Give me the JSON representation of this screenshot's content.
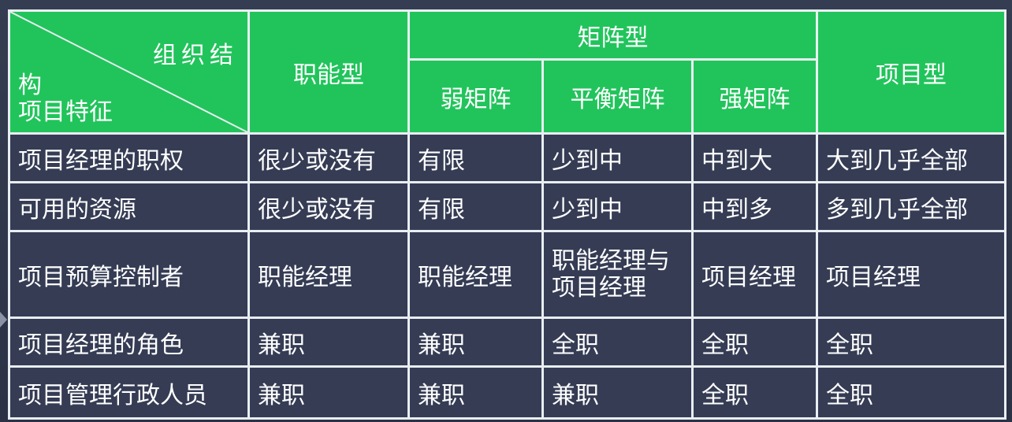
{
  "corner": {
    "org_label_top": "组织结",
    "org_label_bottom": "构",
    "feature_label": "项目特征"
  },
  "headers": {
    "functional": "职能型",
    "matrix": "矩阵型",
    "weak_matrix": "弱矩阵",
    "balanced_matrix": "平衡矩阵",
    "strong_matrix": "强矩阵",
    "projectized": "项目型"
  },
  "rows": [
    {
      "feature": "项目经理的职权",
      "functional": "很少或没有",
      "weak": "有限",
      "balanced": "少到中",
      "strong": "中到大",
      "projectized": "大到几乎全部"
    },
    {
      "feature": "可用的资源",
      "functional": "很少或没有",
      "weak": "有限",
      "balanced": "少到中",
      "strong": "中到多",
      "projectized": "多到几乎全部"
    },
    {
      "feature": "项目预算控制者",
      "functional": "职能经理",
      "weak": "职能经理",
      "balanced": "职能经理与项目经理",
      "strong": "项目经理",
      "projectized": "项目经理"
    },
    {
      "feature": "项目经理的角色",
      "functional": "兼职",
      "weak": "兼职",
      "balanced": "全职",
      "strong": "全职",
      "projectized": "全职"
    },
    {
      "feature": "项目管理行政人员",
      "functional": "兼职",
      "weak": "兼职",
      "balanced": "兼职",
      "strong": "全职",
      "projectized": "全职"
    }
  ],
  "colors": {
    "header_bg": "#21c45b",
    "body_bg": "#353c54",
    "border": "#e9eef2",
    "text": "#ffffff"
  }
}
